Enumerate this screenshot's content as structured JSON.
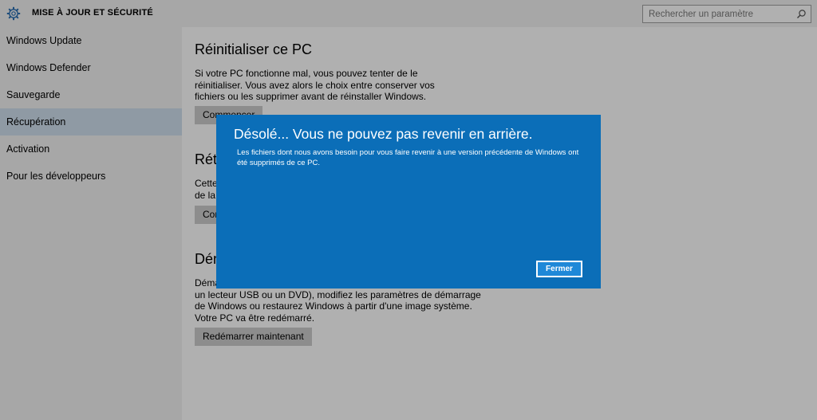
{
  "header": {
    "title": "MISE À JOUR ET SÉCURITÉ",
    "icon": "gear-icon",
    "search": {
      "placeholder": "Rechercher un paramètre",
      "value": "",
      "icon": "search-icon"
    }
  },
  "sidebar": {
    "items": [
      {
        "label": "Windows Update",
        "active": false
      },
      {
        "label": "Windows Defender",
        "active": false
      },
      {
        "label": "Sauvegarde",
        "active": false
      },
      {
        "label": "Récupération",
        "active": true
      },
      {
        "label": "Activation",
        "active": false
      },
      {
        "label": "Pour les développeurs",
        "active": false
      }
    ]
  },
  "main": {
    "sections": [
      {
        "title": "Réinitialiser ce PC",
        "text": "Si votre PC fonctionne mal, vous pouvez tenter de le réinitialiser. Vous avez alors le choix entre conserver vos fichiers ou les supprimer avant de réinstaller Windows.",
        "button": "Commencer"
      },
      {
        "title": "Rétr",
        "text": "Cette\nde la",
        "button": "Cor"
      },
      {
        "title": "Dém",
        "text_lines": [
          "Déma",
          "un lecteur USB ou un DVD), modifiez les paramètres de démarrage",
          "de Windows ou restaurez Windows à partir d'une image système.",
          "Votre PC va être redémarré."
        ],
        "button": "Redémarrer maintenant"
      }
    ]
  },
  "dialog": {
    "title": "Désolé... Vous ne pouvez pas revenir en arrière.",
    "message": "Les fichiers dont nous avons besoin pour vous faire revenir à une version précédente de Windows ont été supprimés de ce PC.",
    "close_button": "Fermer",
    "background_color": "#0b6eb8"
  }
}
